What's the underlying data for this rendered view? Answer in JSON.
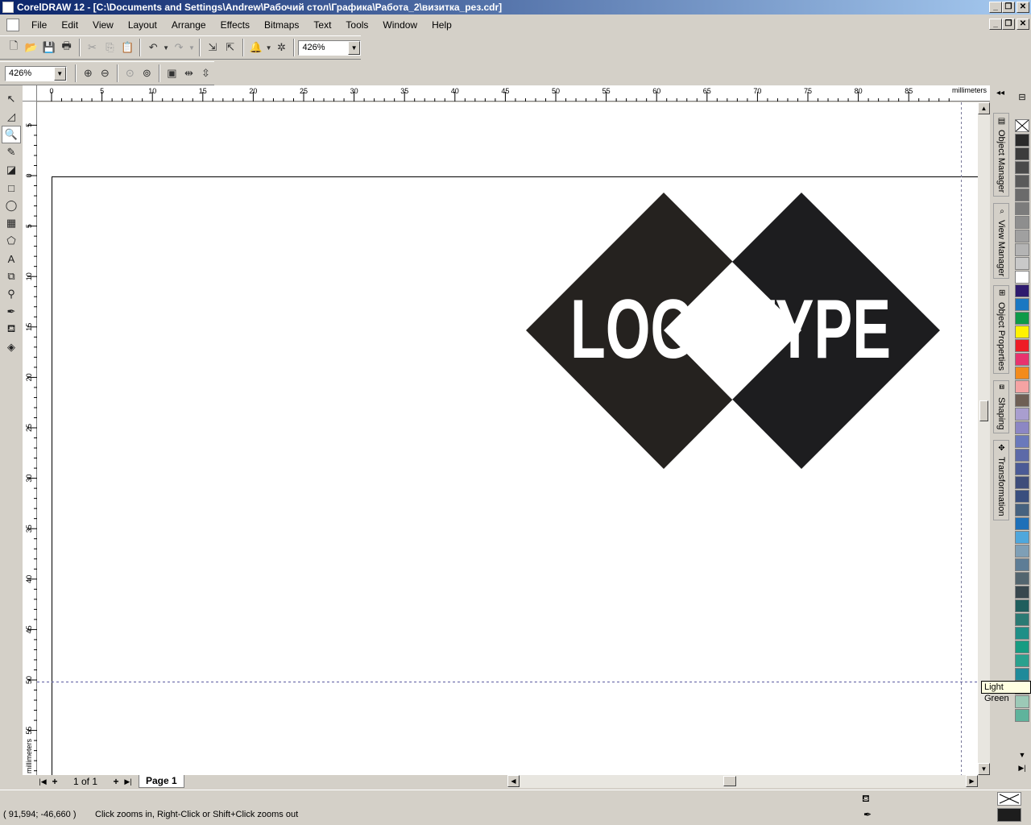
{
  "window": {
    "title": "CorelDRAW 12 - [C:\\Documents and Settings\\Andrew\\Рабочий стол\\Графика\\Работа_2\\визитка_рез.cdr]"
  },
  "menu": [
    "File",
    "Edit",
    "View",
    "Layout",
    "Arrange",
    "Effects",
    "Bitmaps",
    "Text",
    "Tools",
    "Window",
    "Help"
  ],
  "standard_toolbar": {
    "zoom_value": "426%"
  },
  "zoom_toolbar": {
    "zoom_value": "426%"
  },
  "ruler": {
    "units": "millimeters",
    "h_ticks": [
      "0",
      "5",
      "10",
      "15",
      "20",
      "25",
      "30",
      "35",
      "40",
      "45",
      "50",
      "55",
      "60",
      "65",
      "70",
      "75",
      "80",
      "85"
    ],
    "v_ticks": [
      "5",
      "0",
      "5",
      "10",
      "15",
      "20",
      "25",
      "30",
      "35",
      "40",
      "45",
      "50",
      "55"
    ]
  },
  "artwork": {
    "logo_text": "LOGOTYPE",
    "colors": {
      "diamond_left": "#25221f",
      "diamond_right": "#1d1d1f",
      "text": "#ffffff"
    }
  },
  "dockers": [
    "Object Manager",
    "View Manager",
    "Object Properties",
    "Shaping",
    "Transformation"
  ],
  "palette": {
    "colors": [
      "#2b2b2b",
      "#3c3c3c",
      "#4a4a4a",
      "#5a5a5a",
      "#6b6b6b",
      "#7c7c7c",
      "#8e8e8e",
      "#a0a0a0",
      "#b4b4b4",
      "#c9c9c9",
      "#ffffff",
      "#2e1b6e",
      "#1a78c2",
      "#0e9a48",
      "#fff200",
      "#ee1c25",
      "#e8336e",
      "#f38b1c",
      "#f5a3a3",
      "#6e5f55",
      "#a99ecf",
      "#8c87c4",
      "#6a79bb",
      "#5d6aa8",
      "#4b5b96",
      "#3e4d7a",
      "#3a4f7e",
      "#46627f",
      "#1e70b8",
      "#4fa7dc",
      "#7f9fb6",
      "#5e7d96",
      "#53656f",
      "#38474e",
      "#1f5e5d",
      "#2b7a74",
      "#1f8f87",
      "#179c82",
      "#2aa18e",
      "#1f8a9a",
      "#73b0a0",
      "#9cc9b7",
      "#5fb39c"
    ],
    "tooltip": "Light Green"
  },
  "pages": {
    "counter": "1 of 1",
    "current_tab": "Page 1"
  },
  "status": {
    "coords": "( 91,594; -46,660 )",
    "hint": "Click zooms in, Right-Click or Shift+Click zooms out"
  }
}
